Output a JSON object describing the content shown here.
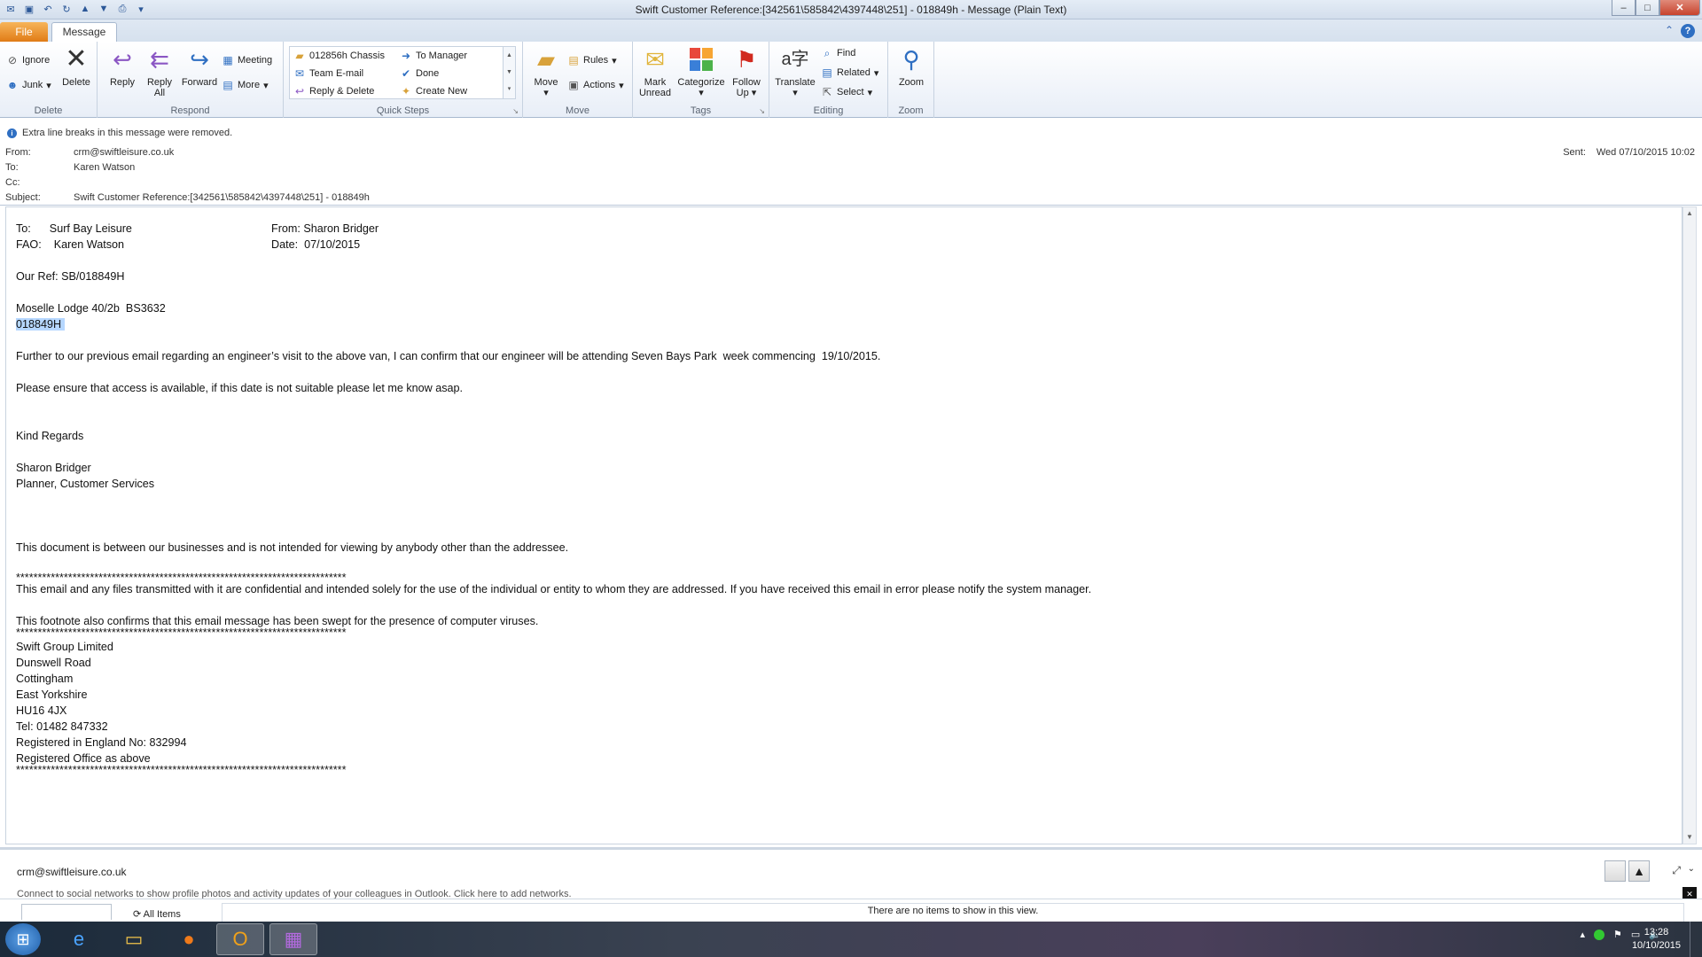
{
  "window": {
    "title": "Swift Customer Reference:[342561\\585842\\4397448\\251] - 018849h  -  Message (Plain Text)",
    "controls": {
      "minimize": "–",
      "maximize": "□",
      "close": "✕"
    }
  },
  "tabs": {
    "file": "File",
    "message": "Message"
  },
  "ribbon": {
    "delete_group": {
      "ignore": "Ignore",
      "junk": "Junk",
      "delete": "Delete",
      "label": "Delete"
    },
    "respond_group": {
      "reply": "Reply",
      "reply_all_1": "Reply",
      "reply_all_2": "All",
      "forward": "Forward",
      "meeting": "Meeting",
      "more": "More",
      "label": "Respond"
    },
    "quick_steps": {
      "items": [
        "012856h Chassis",
        "Team E-mail",
        "Reply & Delete",
        "To Manager",
        "Done",
        "Create New"
      ],
      "label": "Quick Steps"
    },
    "move_group": {
      "move": "Move",
      "rules": "Rules",
      "actions": "Actions",
      "label": "Move"
    },
    "tags_group": {
      "mark_unread_1": "Mark",
      "mark_unread_2": "Unread",
      "categorize": "Categorize",
      "follow_up_1": "Follow",
      "follow_up_2": "Up",
      "label": "Tags"
    },
    "editing_group": {
      "translate": "Translate",
      "find": "Find",
      "related": "Related",
      "select": "Select",
      "label": "Editing"
    },
    "zoom_group": {
      "zoom": "Zoom",
      "label": "Zoom"
    }
  },
  "header": {
    "info": "Extra line breaks in this message were removed.",
    "from_label": "From:",
    "from": "crm@swiftleisure.co.uk",
    "to_label": "To:",
    "to": "Karen Watson",
    "cc_label": "Cc:",
    "cc": "",
    "subject_label": "Subject:",
    "subject": "Swift Customer Reference:[342561\\585842\\4397448\\251] - 018849h",
    "sent_label": "Sent:",
    "sent": "Wed 07/10/2015 10:02"
  },
  "body": {
    "to_line": "To:      Surf Bay Leisure",
    "to_from": "From: Sharon Bridger",
    "fao_line": "FAO:    Karen Watson",
    "fao_date": "Date:  07/10/2015",
    "ref": "Our Ref: SB/018849H",
    "lodge": "Moselle Lodge 40/2b  BS3632",
    "ref_selected": "018849H ",
    "para1": "Further to our previous email regarding an engineer’s visit to the above van, I can confirm that our engineer will be attending Seven Bays Park  week commencing  19/10/2015.",
    "para2": "Please ensure that access is available, if this date is not suitable please let me know asap.",
    "regards": "Kind Regards",
    "sig_name": "Sharon Bridger",
    "sig_title": "Planner, Customer Services",
    "doc_notice": "This document is between our businesses and is not intended for viewing by anybody other than the addressee.",
    "stars": "****************************************************************************",
    "confidential": "This email and any files transmitted with it are confidential and intended solely for the use of the individual or entity to whom they are addressed. If you have received this email in error please notify the system manager.",
    "footnote": "This footnote also confirms that this email message has been swept for the presence of computer viruses.",
    "addr1": "Swift Group Limited",
    "addr2": "Dunswell Road",
    "addr3": "Cottingham",
    "addr4": "East Yorkshire",
    "addr5": "HU16 4JX",
    "tel": "Tel: 01482 847332",
    "reg": "Registered in England No: 832994",
    "office": "Registered Office as above"
  },
  "people_pane": {
    "email": "crm@swiftleisure.co.uk",
    "social": "Connect to social networks to show profile photos and activity updates of your colleagues in Outlook. Click here to add networks.",
    "all_items": "All Items",
    "no_items": "There are no items to show in this view."
  },
  "taskbar": {
    "time": "13:28",
    "date": "10/10/2015"
  }
}
